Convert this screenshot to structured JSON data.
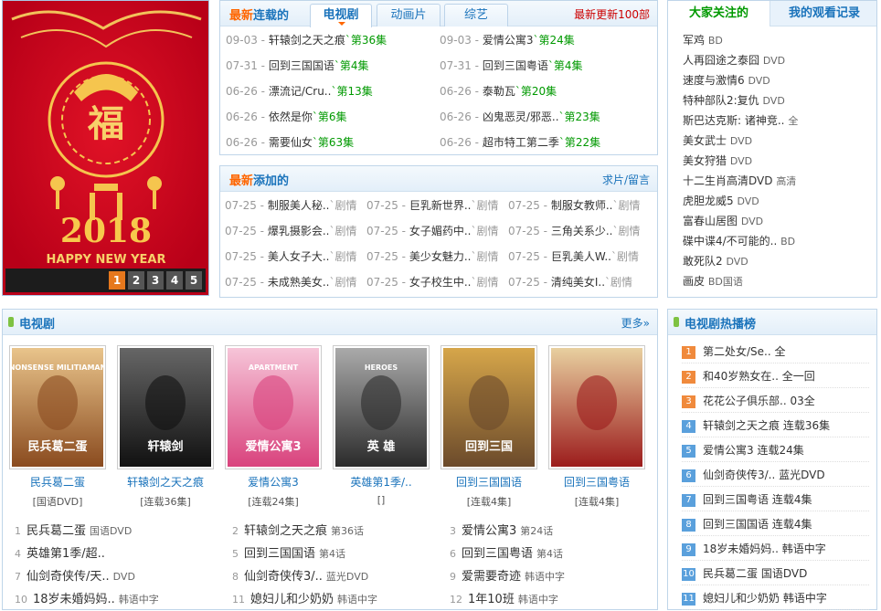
{
  "banner": {
    "year": "2018",
    "slogan": "HAPPY NEW YEAR",
    "glyph": "福",
    "pages": [
      "1",
      "2",
      "3",
      "4",
      "5"
    ],
    "active_page": "1"
  },
  "serial": {
    "title_a": "最新",
    "title_b": "连载的",
    "tabs": [
      "电视剧",
      "动画片",
      "综艺"
    ],
    "more": "最新更新100部",
    "rows": [
      {
        "date": "09-03 -",
        "title": "轩辕剑之天之痕",
        "ep": "`第36集"
      },
      {
        "date": "09-03 -",
        "title": "爱情公寓3",
        "ep": "`第24集"
      },
      {
        "date": "07-31 -",
        "title": "回到三国国语",
        "ep": "`第4集"
      },
      {
        "date": "07-31 -",
        "title": "回到三国粤语",
        "ep": "`第4集"
      },
      {
        "date": "06-26 -",
        "title": "漂流记/Cru..",
        "ep": "`第13集"
      },
      {
        "date": "06-26 -",
        "title": "泰勒瓦",
        "ep": "`第20集"
      },
      {
        "date": "06-26 -",
        "title": "依然是你",
        "ep": "`第6集"
      },
      {
        "date": "06-26 -",
        "title": "凶鬼恶灵/邪恶..",
        "ep": "`第23集"
      },
      {
        "date": "06-26 -",
        "title": "需要仙女",
        "ep": "`第63集"
      },
      {
        "date": "06-26 -",
        "title": "超市特工第二季",
        "ep": "`第22集"
      }
    ]
  },
  "added": {
    "title_a": "最新",
    "title_b": "添加的",
    "more": "求片/留言",
    "rows": [
      {
        "date": "07-25 -",
        "title": "制服美人秘..",
        "tag": "`剧情"
      },
      {
        "date": "07-25 -",
        "title": "巨乳新世界..",
        "tag": "`剧情"
      },
      {
        "date": "07-25 -",
        "title": "制服女教师..",
        "tag": "`剧情"
      },
      {
        "date": "07-25 -",
        "title": "爆乳摄影会..",
        "tag": "`剧情"
      },
      {
        "date": "07-25 -",
        "title": "女子媚药中..",
        "tag": "`剧情"
      },
      {
        "date": "07-25 -",
        "title": "三角关系少..",
        "tag": "`剧情"
      },
      {
        "date": "07-25 -",
        "title": "美人女子大..",
        "tag": "`剧情"
      },
      {
        "date": "07-25 -",
        "title": "美少女魅力..",
        "tag": "`剧情"
      },
      {
        "date": "07-25 -",
        "title": "巨乳美人W..",
        "tag": "`剧情"
      },
      {
        "date": "07-25 -",
        "title": "未成熟美女..",
        "tag": "`剧情"
      },
      {
        "date": "07-25 -",
        "title": "女子校生中..",
        "tag": "`剧情"
      },
      {
        "date": "07-25 -",
        "title": "清纯美女I..",
        "tag": "`剧情"
      }
    ]
  },
  "attention": {
    "tabs": [
      "大家关注的",
      "我的观看记录"
    ],
    "items": [
      {
        "title": "军鸡",
        "tag": "BD"
      },
      {
        "title": "人再囧途之泰囧",
        "tag": "DVD"
      },
      {
        "title": "速度与激情6",
        "tag": "DVD"
      },
      {
        "title": "特种部队2:复仇",
        "tag": "DVD"
      },
      {
        "title": "斯巴达克斯: 诸神竞..",
        "tag": "全"
      },
      {
        "title": "美女武士",
        "tag": "DVD"
      },
      {
        "title": "美女狩猎",
        "tag": "DVD"
      },
      {
        "title": "十二生肖高清DVD",
        "tag": "高清"
      },
      {
        "title": "虎胆龙威5",
        "tag": "DVD"
      },
      {
        "title": "富春山居图",
        "tag": "DVD"
      },
      {
        "title": "碟中谍4/不可能的..",
        "tag": "BD"
      },
      {
        "title": "敢死队2",
        "tag": "DVD"
      },
      {
        "title": "画皮",
        "tag": "BD国语"
      }
    ]
  },
  "tv": {
    "title": "电视剧",
    "more": "更多»",
    "posters": [
      {
        "title": "民兵葛二蛋",
        "sub": "[国语DVD]",
        "art": "NONSENSE MILITIAMAN",
        "art_cn": "民兵葛二蛋"
      },
      {
        "title": "轩辕剑之天之痕",
        "sub": "[连载36集]",
        "art": "",
        "art_cn": "轩辕剑"
      },
      {
        "title": "爱情公寓3",
        "sub": "[连载24集]",
        "art": "APARTMENT",
        "art_cn": "爱情公寓3"
      },
      {
        "title": "英雄第1季/..",
        "sub": "[]",
        "art": "HEROES",
        "art_cn": "英 雄"
      },
      {
        "title": "回到三国国语",
        "sub": "[连载4集]",
        "art": "",
        "art_cn": "回到三国"
      },
      {
        "title": "回到三国粤语",
        "sub": "[连载4集]",
        "art": "",
        "art_cn": ""
      }
    ],
    "list": [
      {
        "n": "1",
        "title": "民兵葛二蛋",
        "tag": "国语DVD"
      },
      {
        "n": "2",
        "title": "轩辕剑之天之痕",
        "tag": "第36话"
      },
      {
        "n": "3",
        "title": "爱情公寓3",
        "tag": "第24话"
      },
      {
        "n": "4",
        "title": "英雄第1季/超..",
        "tag": ""
      },
      {
        "n": "5",
        "title": "回到三国国语",
        "tag": "第4话"
      },
      {
        "n": "6",
        "title": "回到三国粤语",
        "tag": "第4话"
      },
      {
        "n": "7",
        "title": "仙剑奇侠传/天..",
        "tag": "DVD"
      },
      {
        "n": "8",
        "title": "仙剑奇侠传3/..",
        "tag": "蓝光DVD"
      },
      {
        "n": "9",
        "title": "爱需要奇迹",
        "tag": "韩语中字"
      },
      {
        "n": "10",
        "title": "18岁未婚妈妈..",
        "tag": "韩语中字"
      },
      {
        "n": "11",
        "title": "媳妇儿和少奶奶",
        "tag": "韩语中字"
      },
      {
        "n": "12",
        "title": "1年10班",
        "tag": "韩语中字"
      }
    ]
  },
  "hot": {
    "title": "电视剧热播榜",
    "items": [
      {
        "n": "1",
        "title": "第二处女/Se..",
        "tag": "全"
      },
      {
        "n": "2",
        "title": "和40岁熟女在..",
        "tag": "全一回"
      },
      {
        "n": "3",
        "title": "花花公子俱乐部..",
        "tag": "03全"
      },
      {
        "n": "4",
        "title": "轩辕剑之天之痕",
        "tag": "连载36集"
      },
      {
        "n": "5",
        "title": "爱情公寓3",
        "tag": "连载24集"
      },
      {
        "n": "6",
        "title": "仙剑奇侠传3/..",
        "tag": "蓝光DVD"
      },
      {
        "n": "7",
        "title": "回到三国粤语",
        "tag": "连载4集"
      },
      {
        "n": "8",
        "title": "回到三国国语",
        "tag": "连载4集"
      },
      {
        "n": "9",
        "title": "18岁未婚妈妈..",
        "tag": "韩语中字"
      },
      {
        "n": "10",
        "title": "民兵葛二蛋",
        "tag": "国语DVD"
      },
      {
        "n": "11",
        "title": "媳妇儿和少奶奶",
        "tag": "韩语中字"
      }
    ]
  },
  "colors": {
    "accent": "#1a73bb",
    "orange": "#ff6600",
    "green": "#009900",
    "hot_top": "#f08a3c",
    "hot_rest": "#5aa0dc"
  }
}
